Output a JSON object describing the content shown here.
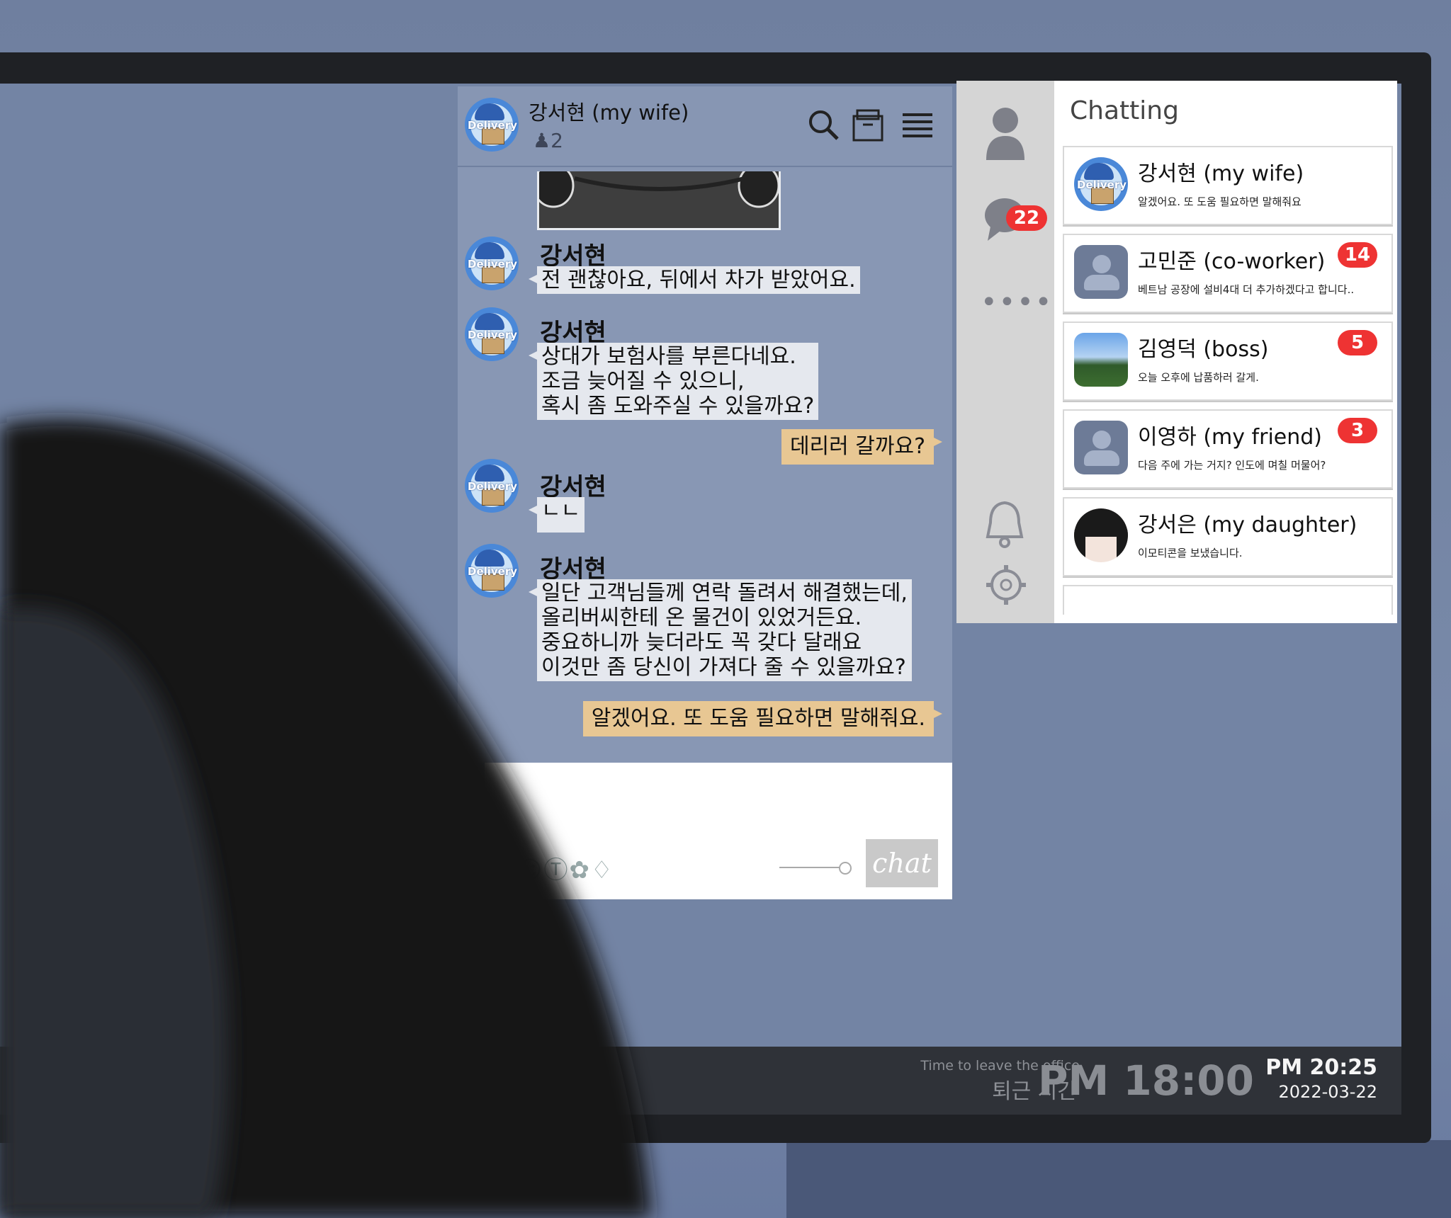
{
  "chat": {
    "title": "강서현 (my wife)",
    "member_count": "2",
    "photo_label": "",
    "messages": [
      {
        "sender": "강서현",
        "text": "전 괜찮아요, 뒤에서 차가 받았어요."
      },
      {
        "sender": "강서현",
        "text": "상대가 보험사를 부른다네요.\n조금 늦어질 수 있으니,\n혹시 좀 도와주실 수 있을까요?"
      },
      {
        "sender": "me",
        "text": "데리러 갈까요?"
      },
      {
        "sender": "강서현",
        "text": "ㄴㄴ"
      },
      {
        "sender": "강서현",
        "text": "일단 고객님들께 연락 돌려서 해결했는데,\n올리버씨한테 온 물건이 있었거든요.\n중요하니까 늦더라도 꼭 갖다 달래요\n이것만 좀 당신이 가져다 줄 수 있을까요?"
      },
      {
        "sender": "me",
        "text": "알겠어요. 또 도움 필요하면 말해줘요."
      }
    ],
    "avatar_text": "Delivery",
    "send_label": "chat"
  },
  "sidebar": {
    "chat_badge": "22"
  },
  "chat_list": {
    "title": "Chatting",
    "items": [
      {
        "name": "강서현 (my wife)",
        "preview": "알겠어요. 또 도움 필요하면 말해줘요",
        "badge": ""
      },
      {
        "name": "고민준 (co-worker)",
        "preview": "베트남 공장에 설비4대 더 추가하겠다고 합니다..",
        "badge": "14"
      },
      {
        "name": "김영덕 (boss)",
        "preview": "오늘 오후에 납품하러 갈게.",
        "badge": "5"
      },
      {
        "name": "이영하 (my friend)",
        "preview": "다음 주에 가는 거지? 인도에 며칠 머물어?",
        "badge": "3"
      },
      {
        "name": "강서은 (my daughter)",
        "preview": "이모티콘을 보냈습니다.",
        "badge": ""
      }
    ]
  },
  "taskbar": {
    "leave_en": "Time to leave the office",
    "leave_ko": "퇴근 시간",
    "leave_time": "PM 18:00",
    "clock_time": "PM 20:25",
    "clock_date": "2022-03-22"
  },
  "colors": {
    "badge": "#e33333",
    "my_bubble": "#e8c793",
    "their_bubble": "#e5e8ee",
    "screen_bg": "#7384a4"
  }
}
